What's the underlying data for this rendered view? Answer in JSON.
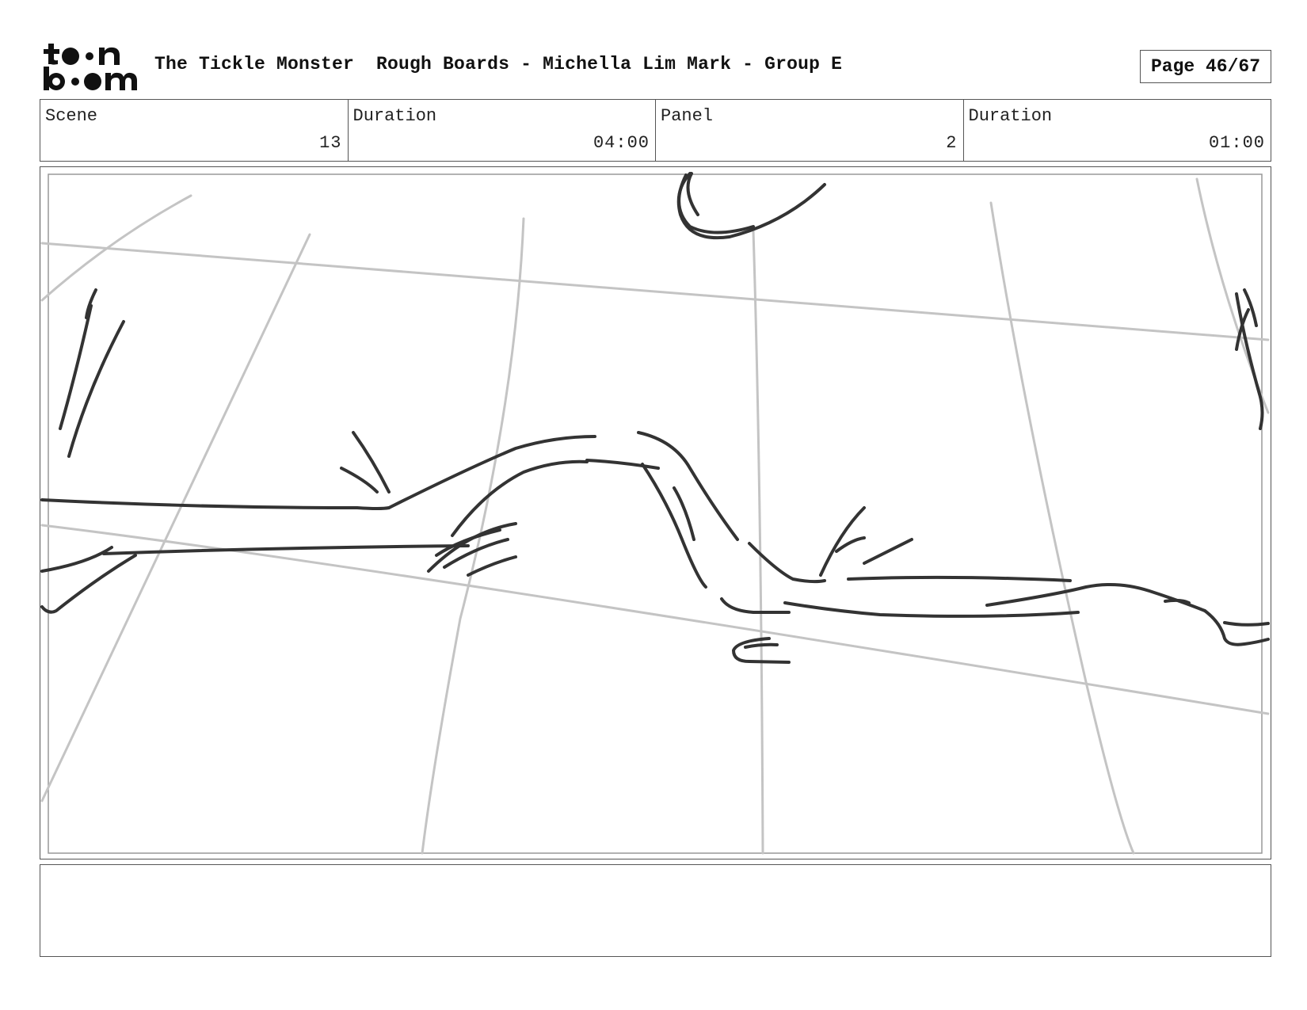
{
  "header": {
    "logo_text": "toon boom",
    "title": "The Tickle Monster  Rough Boards - Michella Lim Mark - Group E",
    "page": "Page 46/67"
  },
  "info": {
    "scene_label": "Scene",
    "scene_value": "13",
    "scene_duration_label": "Duration",
    "scene_duration_value": "04:00",
    "panel_label": "Panel",
    "panel_value": "2",
    "panel_duration_label": "Duration",
    "panel_duration_value": "01:00"
  },
  "notes": {
    "text": ""
  },
  "colors": {
    "border": "#555555",
    "sketch_dark": "#333333",
    "sketch_light": "#bbbbbb"
  }
}
